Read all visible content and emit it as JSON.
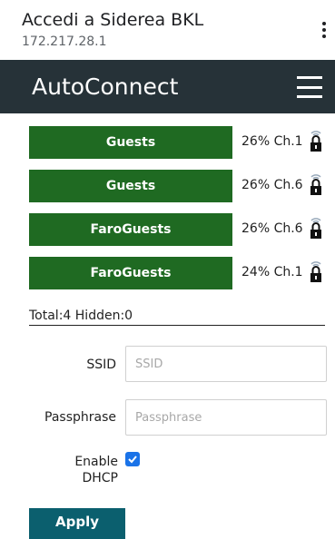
{
  "header": {
    "title": "Accedi a Siderea BKL",
    "address": "172.217.28.1",
    "more_icon": "kebab-menu-icon"
  },
  "navbar": {
    "brand": "AutoConnect",
    "menu_icon": "hamburger-menu-icon"
  },
  "networks": [
    {
      "ssid": "Guests",
      "signal": "26%",
      "channel": "Ch.1",
      "secured": true
    },
    {
      "ssid": "Guests",
      "signal": "26%",
      "channel": "Ch.6",
      "secured": true
    },
    {
      "ssid": "FaroGuests",
      "signal": "26%",
      "channel": "Ch.6",
      "secured": true
    },
    {
      "ssid": "FaroGuests",
      "signal": "24%",
      "channel": "Ch.1",
      "secured": true
    }
  ],
  "summary": "Total:4 Hidden:0",
  "form": {
    "ssid_label": "SSID",
    "ssid_placeholder": "SSID",
    "passphrase_label": "Passphrase",
    "passphrase_placeholder": "Passphrase",
    "dhcp_label_line1": "Enable",
    "dhcp_label_line2": "DHCP",
    "dhcp_checked": true,
    "apply_label": "Apply"
  },
  "colors": {
    "navbar": "#263238",
    "network_button": "#1f6a22",
    "apply_button": "#0b5f6e",
    "checkbox": "#1a73e8"
  }
}
